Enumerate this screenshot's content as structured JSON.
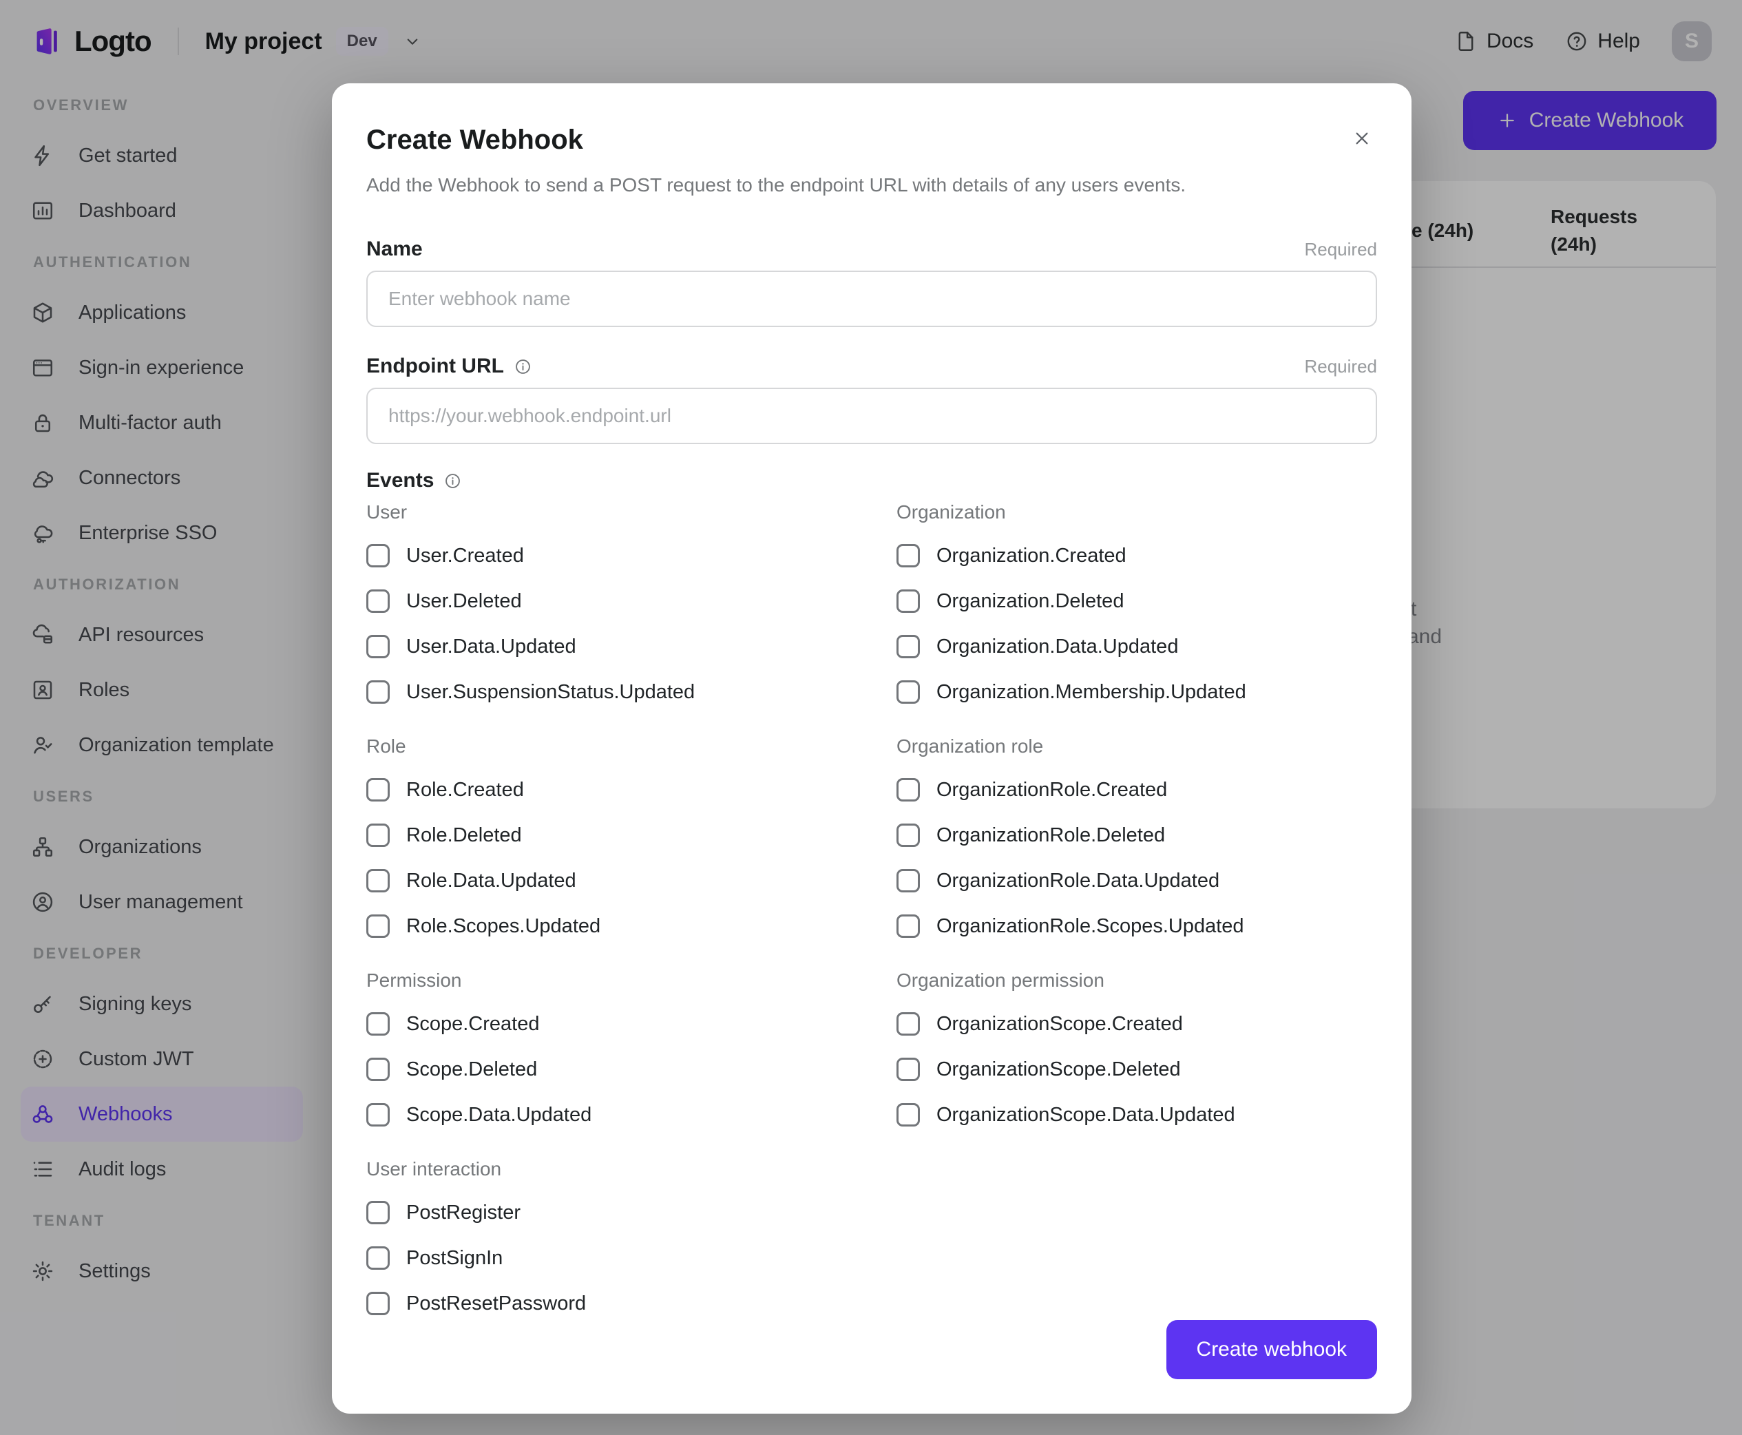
{
  "topbar": {
    "logo_text": "Logto",
    "project_name": "My project",
    "env_badge": "Dev",
    "docs_label": "Docs",
    "help_label": "Help",
    "avatar_initial": "S",
    "icons": [
      "logto-logo-icon",
      "chevron-down-icon",
      "document-icon",
      "help-icon"
    ]
  },
  "sidebar": {
    "sections": [
      {
        "label": "OVERVIEW",
        "items": [
          {
            "label": "Get started",
            "icon": "lightning-icon"
          },
          {
            "label": "Dashboard",
            "icon": "bar-chart-icon"
          }
        ]
      },
      {
        "label": "AUTHENTICATION",
        "items": [
          {
            "label": "Applications",
            "icon": "box-icon"
          },
          {
            "label": "Sign-in experience",
            "icon": "browser-icon"
          },
          {
            "label": "Multi-factor auth",
            "icon": "lock-icon"
          },
          {
            "label": "Connectors",
            "icon": "connectors-icon"
          },
          {
            "label": "Enterprise SSO",
            "icon": "cloud-sso-icon"
          }
        ]
      },
      {
        "label": "AUTHORIZATION",
        "items": [
          {
            "label": "API resources",
            "icon": "api-resources-icon"
          },
          {
            "label": "Roles",
            "icon": "role-icon"
          },
          {
            "label": "Organization template",
            "icon": "person-check-icon"
          }
        ]
      },
      {
        "label": "USERS",
        "items": [
          {
            "label": "Organizations",
            "icon": "org-chart-icon"
          },
          {
            "label": "User management",
            "icon": "user-circle-icon"
          }
        ]
      },
      {
        "label": "DEVELOPER",
        "items": [
          {
            "label": "Signing keys",
            "icon": "key-icon"
          },
          {
            "label": "Custom JWT",
            "icon": "badge-plus-icon"
          },
          {
            "label": "Webhooks",
            "icon": "webhook-icon",
            "active": true
          },
          {
            "label": "Audit logs",
            "icon": "list-icon"
          }
        ]
      },
      {
        "label": "TENANT",
        "items": [
          {
            "label": "Settings",
            "icon": "gear-icon"
          }
        ]
      }
    ]
  },
  "background": {
    "create_button_label": "Create Webhook",
    "table_header_fragment_1": "e (24h)",
    "table_header_fragment_2_line1": "Requests",
    "table_header_fragment_2_line2": "(24h)",
    "empty_text_fragment_1": "t",
    "empty_text_fragment_2": "and"
  },
  "modal": {
    "title": "Create Webhook",
    "description": "Add the Webhook to send a POST request to the endpoint URL with details of any users events.",
    "name_field": {
      "label": "Name",
      "required": "Required",
      "placeholder": "Enter webhook name",
      "value": ""
    },
    "endpoint_field": {
      "label": "Endpoint URL",
      "required": "Required",
      "placeholder": "https://your.webhook.endpoint.url",
      "value": ""
    },
    "events_label": "Events",
    "event_columns": [
      [
        {
          "group": "User",
          "items": [
            "User.Created",
            "User.Deleted",
            "User.Data.Updated",
            "User.SuspensionStatus.Updated"
          ]
        },
        {
          "group": "Role",
          "items": [
            "Role.Created",
            "Role.Deleted",
            "Role.Data.Updated",
            "Role.Scopes.Updated"
          ]
        },
        {
          "group": "Permission",
          "items": [
            "Scope.Created",
            "Scope.Deleted",
            "Scope.Data.Updated"
          ]
        },
        {
          "group": "User interaction",
          "items": [
            "PostRegister",
            "PostSignIn",
            "PostResetPassword"
          ]
        }
      ],
      [
        {
          "group": "Organization",
          "items": [
            "Organization.Created",
            "Organization.Deleted",
            "Organization.Data.Updated",
            "Organization.Membership.Updated"
          ]
        },
        {
          "group": "Organization role",
          "items": [
            "OrganizationRole.Created",
            "OrganizationRole.Deleted",
            "OrganizationRole.Data.Updated",
            "OrganizationRole.Scopes.Updated"
          ]
        },
        {
          "group": "Organization permission",
          "items": [
            "OrganizationScope.Created",
            "OrganizationScope.Deleted",
            "OrganizationScope.Data.Updated"
          ]
        }
      ]
    ],
    "checkboxes_checked": false,
    "submit_label": "Create webhook"
  },
  "colors": {
    "accent": "#5d34f2",
    "sidebar_active_bg": "#ece4fb",
    "app_background": "#f1f1f3",
    "overlay": "rgba(0,0,0,0.30)"
  }
}
